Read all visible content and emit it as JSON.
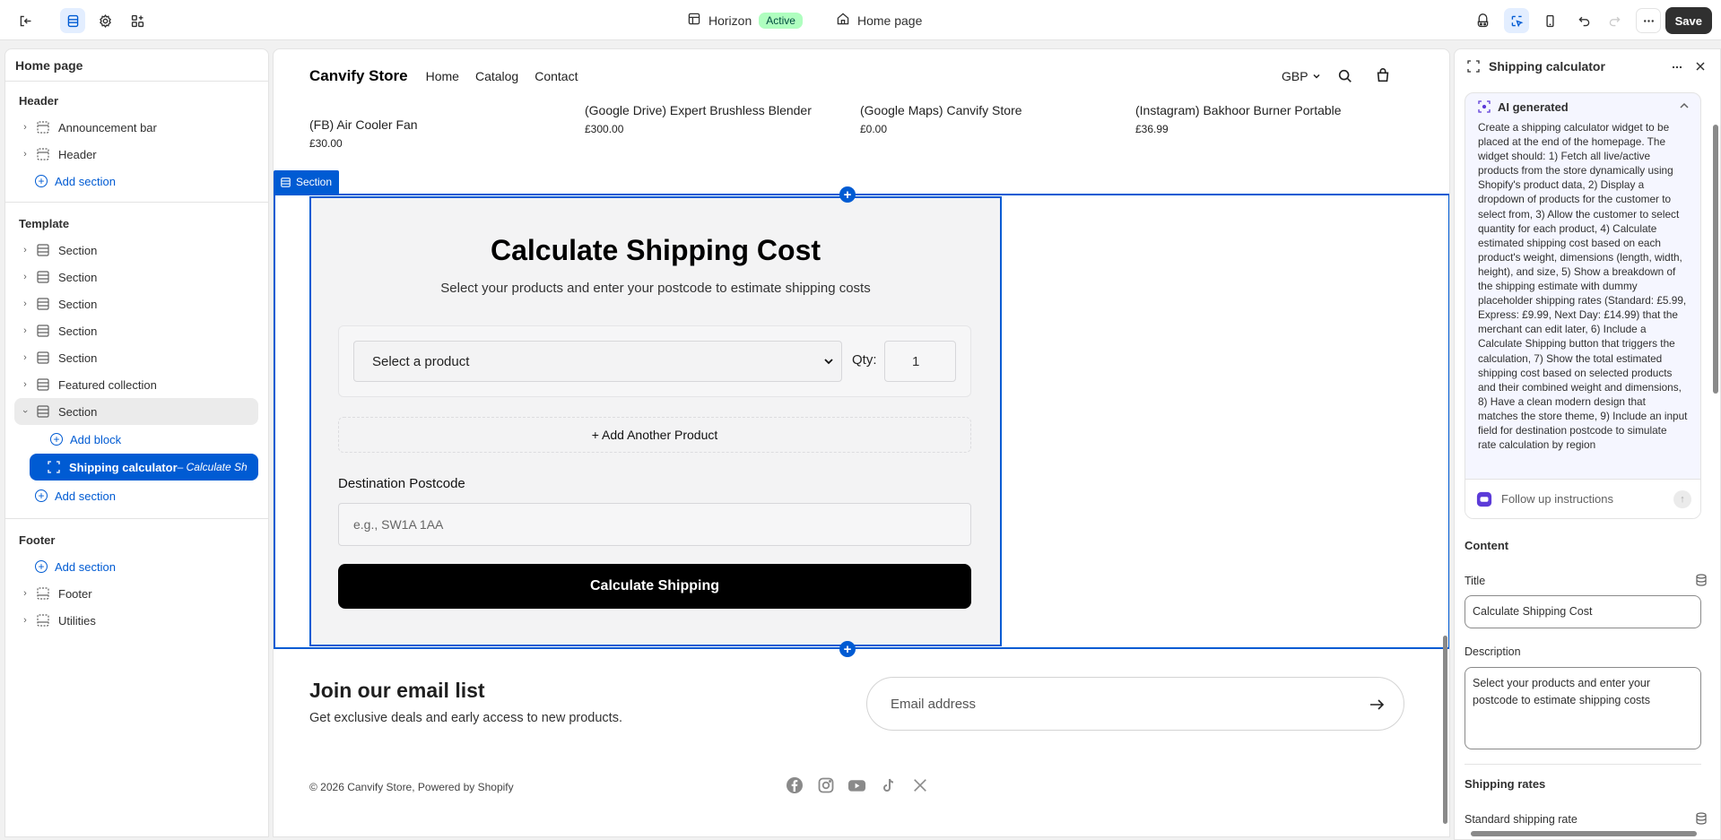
{
  "topbar": {
    "theme_name": "Horizon",
    "theme_status": "Active",
    "page_name": "Home page",
    "save_label": "Save"
  },
  "left_panel": {
    "title": "Home page",
    "header_group": {
      "title": "Header",
      "items": [
        "Announcement bar",
        "Header"
      ],
      "add_section": "Add section"
    },
    "template_group": {
      "title": "Template",
      "items": [
        "Section",
        "Section",
        "Section",
        "Section",
        "Section",
        "Featured collection",
        "Section"
      ],
      "add_block": "Add block",
      "active_block": "Shipping calculator",
      "active_block_suffix": " – Calculate Sh",
      "add_section": "Add section"
    },
    "footer_group": {
      "title": "Footer",
      "add_section": "Add section",
      "items": [
        "Footer",
        "Utilities"
      ]
    }
  },
  "canvas": {
    "store_name": "Canvify Store",
    "nav": [
      "Home",
      "Catalog",
      "Contact"
    ],
    "currency": "GBP",
    "products": [
      {
        "name": "(FB) Air Cooler Fan",
        "price": "£30.00"
      },
      {
        "name": "(Google Drive) Expert Brushless Blender",
        "price": "£300.00"
      },
      {
        "name": "(Google Maps) Canvify Store",
        "price": "£0.00"
      },
      {
        "name": "(Instagram) Bakhoor Burner Portable",
        "price": "£36.99"
      }
    ],
    "section_tag": "Section",
    "calculator": {
      "title": "Calculate Shipping Cost",
      "description": "Select your products and enter your postcode to estimate shipping costs",
      "select_placeholder": "Select a product",
      "qty_label": "Qty:",
      "qty_value": "1",
      "add_another": "+ Add Another Product",
      "postcode_label": "Destination Postcode",
      "postcode_placeholder": "e.g., SW1A 1AA",
      "button": "Calculate Shipping"
    },
    "newsletter": {
      "title": "Join our email list",
      "subtitle": "Get exclusive deals and early access to new products.",
      "placeholder": "Email address"
    },
    "copyright": "© 2026 Canvify Store, Powered by Shopify",
    "socials": [
      "facebook-icon",
      "instagram-icon",
      "youtube-icon",
      "tiktok-icon",
      "x-icon"
    ]
  },
  "right_panel": {
    "title": "Shipping calculator",
    "ai_title": "AI generated",
    "ai_text": "Create a shipping calculator widget to be placed at the end of the homepage. The widget should: 1) Fetch all live/active products from the store dynamically using Shopify's product data, 2) Display a dropdown of products for the customer to select from, 3) Allow the customer to select quantity for each product, 4) Calculate estimated shipping cost based on each product's weight, dimensions (length, width, height), and size, 5) Show a breakdown of the shipping estimate with dummy placeholder shipping rates (Standard: £5.99, Express: £9.99, Next Day: £14.99) that the merchant can edit later, 6) Include a Calculate Shipping button that triggers the calculation, 7) Show the total estimated shipping cost based on selected products and their combined weight and dimensions, 8) Have a clean modern design that matches the store theme, 9) Include an input field for destination postcode to simulate rate calculation by region",
    "follow_placeholder": "Follow up instructions",
    "content_heading": "Content",
    "title_label": "Title",
    "title_value": "Calculate Shipping Cost",
    "description_label": "Description",
    "description_value": "Select your products and enter your postcode to estimate shipping costs",
    "shipping_rates_heading": "Shipping rates",
    "standard_rate_label": "Standard shipping rate"
  },
  "colors": {
    "accent": "#005bd3",
    "save_bg": "#303030",
    "active_badge": "#affebf"
  }
}
